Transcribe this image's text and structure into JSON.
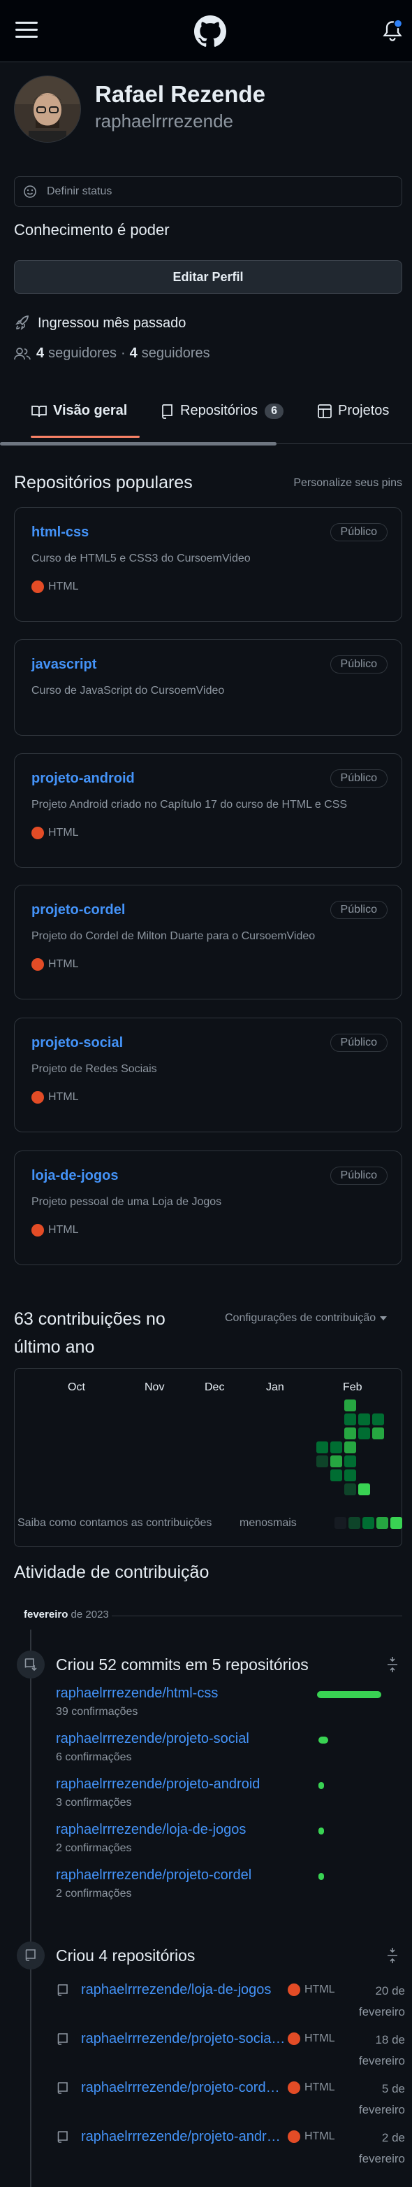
{
  "header": {
    "menu_icon": "hamburger-icon",
    "logo_icon": "github-logo-icon",
    "notifications_icon": "bell-icon"
  },
  "profile": {
    "name": "Rafael Rezende",
    "username": "raphaelrrrezende",
    "status_placeholder": "Definir status",
    "bio": "Conhecimento é poder",
    "edit_button": "Editar Perfil",
    "joined": "Ingressou mês passado",
    "followers_count": "4",
    "followers_label": "seguidores",
    "separator": "·",
    "following_count": "4",
    "following_label": "seguidores"
  },
  "tabs": [
    {
      "label": "Visão geral",
      "icon": "book-icon",
      "active": true
    },
    {
      "label": "Repositórios",
      "icon": "repo-icon",
      "count": "6"
    },
    {
      "label": "Projetos",
      "icon": "table-icon"
    }
  ],
  "popular": {
    "title": "Repositórios populares",
    "customize": "Personalize seus pins",
    "repos": [
      {
        "name": "html-css",
        "badge": "Público",
        "desc": "Curso de HTML5 e CSS3 do CursoemVideo",
        "lang": "HTML"
      },
      {
        "name": "javascript",
        "badge": "Público",
        "desc": "Curso de JavaScript do CursoemVideo",
        "lang": ""
      },
      {
        "name": "projeto-android",
        "badge": "Público",
        "desc": "Projeto Android criado no Capítulo 17 do curso de HTML e CSS",
        "lang": "HTML"
      },
      {
        "name": "projeto-cordel",
        "badge": "Público",
        "desc": "Projeto do Cordel de Milton Duarte para o CursoemVideo",
        "lang": "HTML"
      },
      {
        "name": "projeto-social",
        "badge": "Público",
        "desc": "Projeto de Redes Sociais",
        "lang": "HTML"
      },
      {
        "name": "loja-de-jogos",
        "badge": "Público",
        "desc": "Projeto pessoal de uma Loja de Jogos",
        "lang": "HTML"
      }
    ],
    "lang_color": "#e34c26"
  },
  "contributions": {
    "title_line1": "63 contribuições no",
    "title_line2": "último ano",
    "settings": "Configurações de contribuição",
    "months": [
      "Oct",
      "Nov",
      "Dec",
      "Jan",
      "Feb"
    ],
    "learn_link": "Saiba como contamos as contribuições",
    "less": "menos",
    "more": "mais"
  },
  "activity": {
    "title": "Atividade de contribuição",
    "month": "fevereiro",
    "year": "de 2023",
    "commits_summary": "Criou 52 commits em 5 repositórios",
    "commit_repos": [
      {
        "repo": "raphaelrrrezende/html-css",
        "count": "39 confirmações",
        "share": 0.75
      },
      {
        "repo": "raphaelrrrezende/projeto-social",
        "count": "6 confirmações",
        "share": 0.115
      },
      {
        "repo": "raphaelrrrezende/projeto-android",
        "count": "3 confirmações",
        "share": 0.058
      },
      {
        "repo": "raphaelrrrezende/loja-de-jogos",
        "count": "2 confirmações",
        "share": 0.038
      },
      {
        "repo": "raphaelrrrezende/projeto-cordel",
        "count": "2 confirmações",
        "share": 0.038
      }
    ],
    "repos_summary": "Criou 4 repositórios",
    "new_repos": [
      {
        "repo": "raphaelrrrezende/loja-de-jogos",
        "lang": "HTML",
        "day": "20 de",
        "month": "fevereiro"
      },
      {
        "repo": "raphaelrrrezende/projeto-socia…",
        "lang": "HTML",
        "day": "18 de",
        "month": "fevereiro"
      },
      {
        "repo": "raphaelrrrezende/projeto-cord…",
        "lang": "HTML",
        "day": "5 de",
        "month": "fevereiro"
      },
      {
        "repo": "raphaelrrrezende/projeto-andr…",
        "lang": "HTML",
        "day": "2 de",
        "month": "fevereiro"
      }
    ]
  }
}
